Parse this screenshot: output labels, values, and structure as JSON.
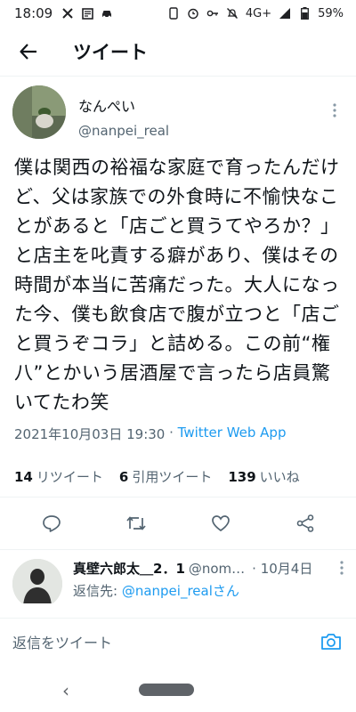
{
  "status_bar": {
    "time": "18:09",
    "network": "4G+",
    "battery": "59%"
  },
  "header": {
    "title": "ツイート"
  },
  "tweet": {
    "display_name": "なんぺい",
    "handle": "@nanpei_real",
    "text": "僕は関西の裕福な家庭で育ったんだけど、父は家族での外食時に不愉快なことがあると「店ごと買うてやろか？」と店主を叱責する癖があり、僕はその時間が本当に苦痛だった。大人になった今、僕も飲食店で腹が立つと「店ごと買うぞコラ」と詰める。この前“権八”とかいう居酒屋で言ったら店員驚いてたわ笑",
    "datetime": "2021年10月03日 19:30",
    "separator": " · ",
    "source": "Twitter Web App"
  },
  "stats": {
    "retweets_count": "14",
    "retweets_label": "リツイート",
    "quotes_count": "6",
    "quotes_label": "引用ツイート",
    "likes_count": "139",
    "likes_label": "いいね"
  },
  "reply": {
    "name": "真壁六郎太＿2．1",
    "handle": "@nom…",
    "date": "· 10月4日",
    "reply_to_prefix": "返信先: ",
    "reply_to_mention": "@nanpei_realさん"
  },
  "compose": {
    "placeholder": "返信をツイート"
  },
  "colors": {
    "accent": "#1d9bf0",
    "secondary_text": "#536471",
    "primary_text": "#0f1419"
  }
}
